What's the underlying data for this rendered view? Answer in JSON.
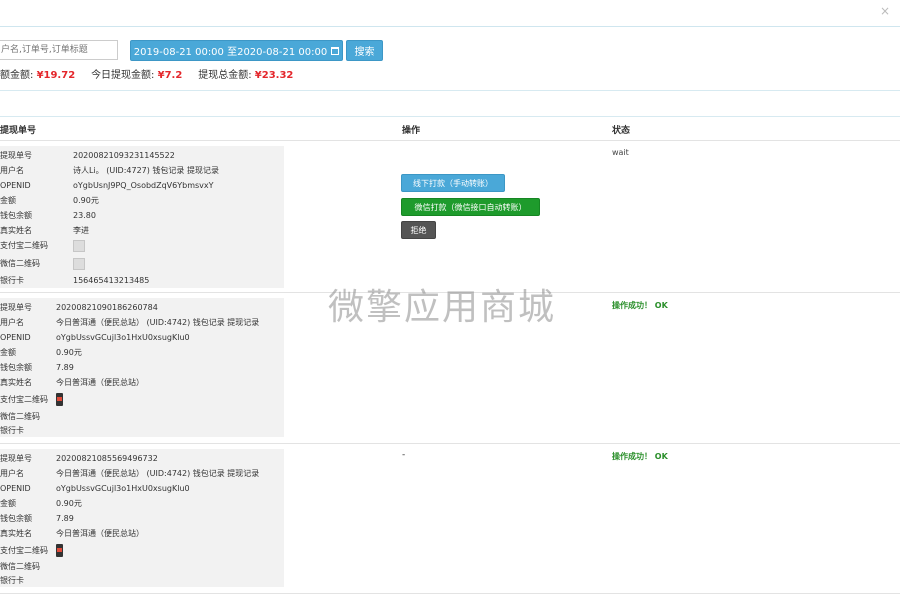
{
  "filter": {
    "search_placeholder": "户名,订单号,订单标题",
    "date_range": "2019-08-21 00:00 至2020-08-21 00:00",
    "search_label": "搜索"
  },
  "summary": {
    "balance_label": "额金额:",
    "balance_value": "¥19.72",
    "today_label": "今日提现金额:",
    "today_value": "¥7.2",
    "total_label": "提现总金额:",
    "total_value": "¥23.32"
  },
  "table": {
    "headers": {
      "order": "提现单号",
      "action": "操作",
      "status": "状态"
    }
  },
  "rows": [
    {
      "fields": [
        {
          "k": "提现单号",
          "v": "20200821093231145522"
        },
        {
          "k": "用户名",
          "v": "诗人Li。 (UID:4727) 钱包记录 提现记录"
        },
        {
          "k": "OPENID",
          "v": "oYgbUsnJ9PQ_OsobdZqV6YbmsvxY"
        },
        {
          "k": "金额",
          "v": "0.90元"
        },
        {
          "k": "钱包余额",
          "v": "23.80"
        },
        {
          "k": "真实姓名",
          "v": "李进"
        },
        {
          "k": "支付宝二维码",
          "v": ""
        },
        {
          "k": "微信二维码",
          "v": ""
        },
        {
          "k": "银行卡",
          "v": "156465413213485"
        }
      ],
      "actions": {
        "offline": "线下打款（手动转账）",
        "wechat": "微信打款（微信接口自动转账）",
        "reject": "拒绝"
      },
      "status": "wait"
    },
    {
      "fields": [
        {
          "k": "提现单号",
          "v": "20200821090186260784"
        },
        {
          "k": "用户名",
          "v": "今日普洱通（便民总站） (UID:4742) 钱包记录 提现记录"
        },
        {
          "k": "OPENID",
          "v": "oYgbUssvGCujl3o1HxU0xsugKlu0"
        },
        {
          "k": "金额",
          "v": "0.90元"
        },
        {
          "k": "钱包余额",
          "v": "7.89"
        },
        {
          "k": "真实姓名",
          "v": "今日普洱通（便民总站）"
        },
        {
          "k": "支付宝二维码",
          "v": ""
        },
        {
          "k": "微信二维码",
          "v": ""
        },
        {
          "k": "银行卡",
          "v": ""
        }
      ],
      "status": "操作成功！ OK"
    },
    {
      "fields": [
        {
          "k": "提现单号",
          "v": "20200821085569496732"
        },
        {
          "k": "用户名",
          "v": "今日普洱通（便民总站） (UID:4742) 钱包记录 提现记录"
        },
        {
          "k": "OPENID",
          "v": "oYgbUssvGCujl3o1HxU0xsugKlu0"
        },
        {
          "k": "金额",
          "v": "0.90元"
        },
        {
          "k": "钱包余额",
          "v": "7.89"
        },
        {
          "k": "真实姓名",
          "v": "今日普洱通（便民总站）"
        },
        {
          "k": "支付宝二维码",
          "v": ""
        },
        {
          "k": "微信二维码",
          "v": ""
        },
        {
          "k": "银行卡",
          "v": ""
        }
      ],
      "action_text": "-",
      "status": "操作成功！ OK"
    }
  ],
  "watermark": "微擎应用商城"
}
